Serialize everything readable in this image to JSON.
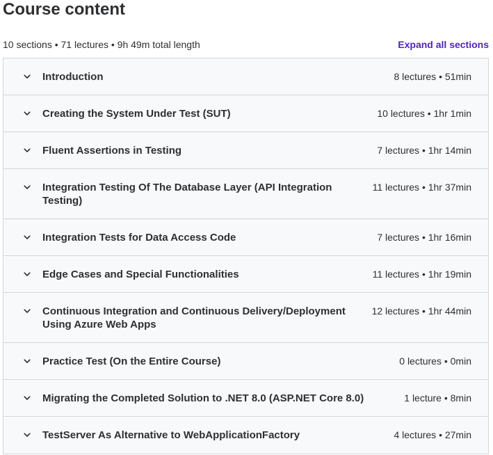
{
  "heading": "Course content",
  "summary": "10 sections • 71 lectures • 9h 49m total length",
  "expand_label": "Expand all sections",
  "icons": {
    "section_toggle": "chevron-down-icon"
  },
  "colors": {
    "accent": "#5022c3",
    "section_bg": "#f7f9fa",
    "border": "#d1d7dc",
    "text": "#2d2f31"
  },
  "sections": [
    {
      "title": "Introduction",
      "meta": "8 lectures • 51min"
    },
    {
      "title": "Creating the System Under Test (SUT)",
      "meta": "10 lectures • 1hr 1min"
    },
    {
      "title": "Fluent Assertions in Testing",
      "meta": "7 lectures • 1hr 14min"
    },
    {
      "title": "Integration Testing Of The Database Layer (API Integration Testing)",
      "meta": "11 lectures • 1hr 37min"
    },
    {
      "title": "Integration Tests for Data Access Code",
      "meta": "7 lectures • 1hr 16min"
    },
    {
      "title": "Edge Cases and Special Functionalities",
      "meta": "11 lectures • 1hr 19min"
    },
    {
      "title": "Continuous Integration and Continuous Delivery/Deployment Using Azure Web Apps",
      "meta": "12 lectures • 1hr 44min"
    },
    {
      "title": "Practice Test (On the Entire Course)",
      "meta": "0 lectures • 0min"
    },
    {
      "title": "Migrating the Completed Solution to .NET 8.0 (ASP.NET Core 8.0)",
      "meta": "1 lecture • 8min"
    },
    {
      "title": "TestServer As Alternative to WebApplicationFactory",
      "meta": "4 lectures • 27min"
    }
  ]
}
